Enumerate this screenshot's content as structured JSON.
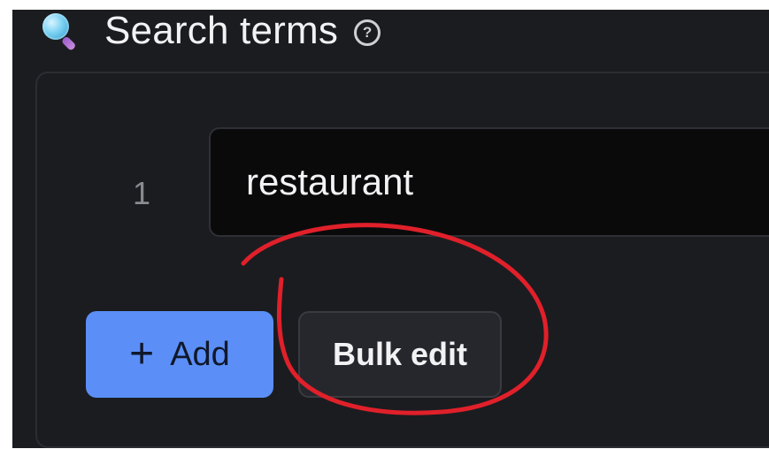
{
  "section": {
    "title": "Search terms",
    "help_symbol": "?",
    "icon": "magnifying-glass-emoji"
  },
  "terms": [
    {
      "index": "1",
      "value": "restaurant"
    }
  ],
  "buttons": {
    "add_symbol": "+",
    "add_label": "Add",
    "bulk_edit_label": "Bulk edit"
  },
  "colors": {
    "background": "#1b1c20",
    "input_background": "#0a0a0b",
    "add_button": "#5b8ff7",
    "bulk_button": "#26272c",
    "annotation": "#e0202a"
  }
}
